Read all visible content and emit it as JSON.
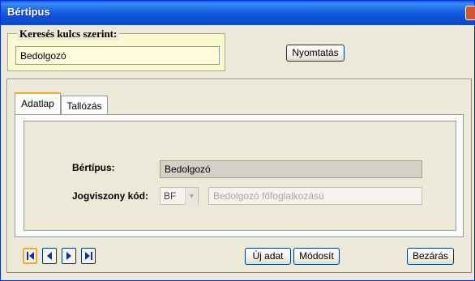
{
  "window": {
    "title": "Bértipus"
  },
  "search": {
    "legend": "Keresés kulcs szerint:",
    "value": "Bedolgozó"
  },
  "toolbar": {
    "print_label": "Nyomtatás"
  },
  "tabs": [
    {
      "label": "Adatlap",
      "active": true
    },
    {
      "label": "Tallózás",
      "active": false
    }
  ],
  "form": {
    "bertipus_label": "Bértípus:",
    "bertipus_value": "Bedolgozó",
    "jogviszony_label": "Jogviszony kód:",
    "jogviszony_code": "BF",
    "jogviszony_desc": "Bedolgozó főfoglalkozású"
  },
  "navigation": {
    "icons": [
      "first-record-icon",
      "previous-record-icon",
      "next-record-icon",
      "last-record-icon"
    ]
  },
  "actions": {
    "new_label": "Új adat",
    "modify_label": "Módosít",
    "close_label": "Bezárás"
  },
  "colors": {
    "titlebar": "#0a4fd6",
    "search_bg": "#fbf9d0",
    "tab_accent": "#f4a935",
    "nav_icon": "#1030a0"
  }
}
